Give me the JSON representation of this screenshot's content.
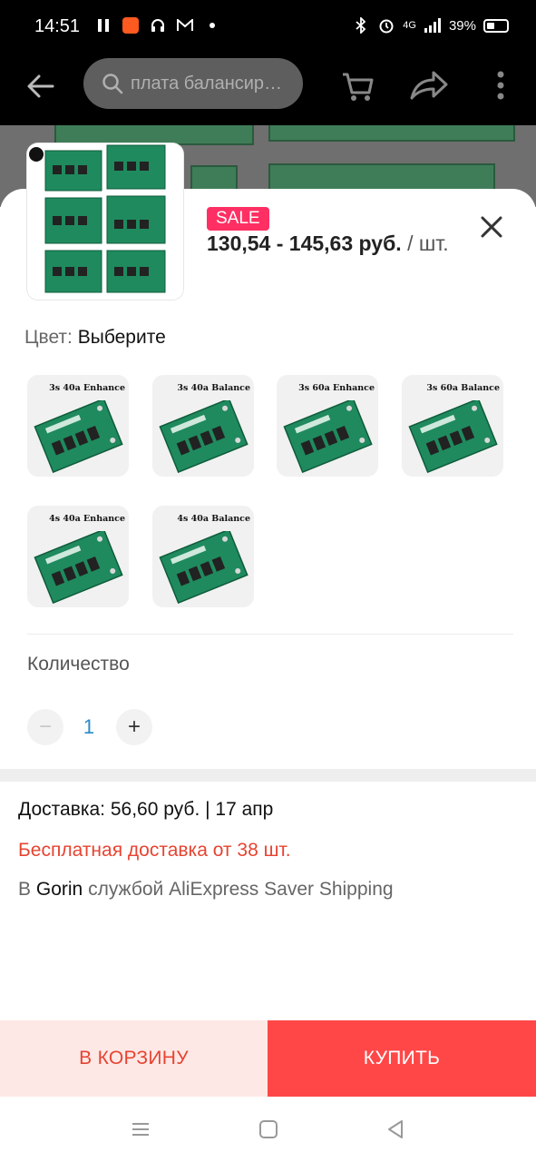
{
  "status_bar": {
    "time": "14:51",
    "network": "4G",
    "battery": "39%"
  },
  "header": {
    "search_placeholder": "плата балансир…"
  },
  "product": {
    "sale_badge": "SALE",
    "price": "130,54 - 145,63 руб.",
    "price_unit": "/ шт."
  },
  "color": {
    "label": "Цвет:",
    "value": "Выберите",
    "options": [
      {
        "caption": "3s 40a  Enhance"
      },
      {
        "caption": "3s 40a  Balance"
      },
      {
        "caption": "3s 60a Enhance"
      },
      {
        "caption": "3s 60a Balance"
      },
      {
        "caption": "4s 40a  Enhance"
      },
      {
        "caption": "4s 40a  Balance"
      }
    ]
  },
  "quantity": {
    "label": "Количество",
    "value": "1",
    "minus": "−",
    "plus": "+"
  },
  "shipping": {
    "delivery": "Доставка: 56,60 руб. | 17 апр",
    "free_delivery": "Бесплатная доставка от 38 шт.",
    "route_prefix": "В",
    "destination": "Gorin",
    "route_suffix": "службой AliExpress Saver Shipping"
  },
  "actions": {
    "add_to_cart": "В КОРЗИНУ",
    "buy": "КУПИТЬ"
  },
  "colors": {
    "accent_red": "#ff4747",
    "sale_pink": "#ff2f63",
    "free_shipping_red": "#e64431",
    "cart_bg": "#fde8e6",
    "qty_blue": "#2a8bc9"
  }
}
